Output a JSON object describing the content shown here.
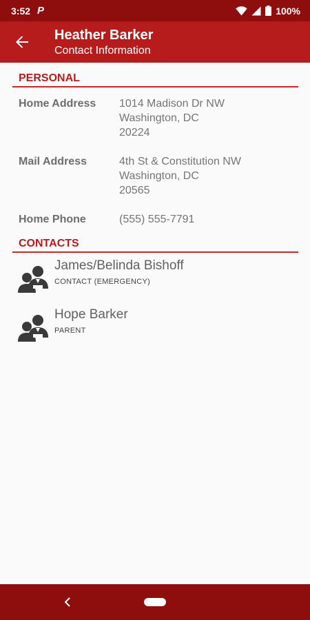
{
  "status_bar": {
    "time": "3:52",
    "notification_icon": "P",
    "battery_text": "100%"
  },
  "app_bar": {
    "title": "Heather Barker",
    "subtitle": "Contact Information"
  },
  "personal": {
    "header": "PERSONAL",
    "fields": [
      {
        "label": "Home Address",
        "lines": [
          "1014 Madison Dr NW",
          "Washington, DC",
          "20224"
        ]
      },
      {
        "label": "Mail Address",
        "lines": [
          "4th St & Constitution NW",
          "Washington, DC",
          "20565"
        ]
      },
      {
        "label": "Home Phone",
        "lines": [
          "(555) 555-7791"
        ]
      }
    ]
  },
  "contacts": {
    "header": "CONTACTS",
    "items": [
      {
        "name": "James/Belinda Bishoff",
        "role": "CONTACT (EMERGENCY)"
      },
      {
        "name": "Hope Barker",
        "role": "PARENT"
      }
    ]
  },
  "colors": {
    "status_bar": "#8e0d0d",
    "app_bar": "#b71c1c",
    "accent": "#c62828",
    "background": "#fafafa"
  },
  "icons": {
    "back": "arrow-left-icon",
    "contact": "people-icon",
    "wifi": "wifi-icon",
    "signal": "signal-icon",
    "battery": "battery-icon"
  }
}
